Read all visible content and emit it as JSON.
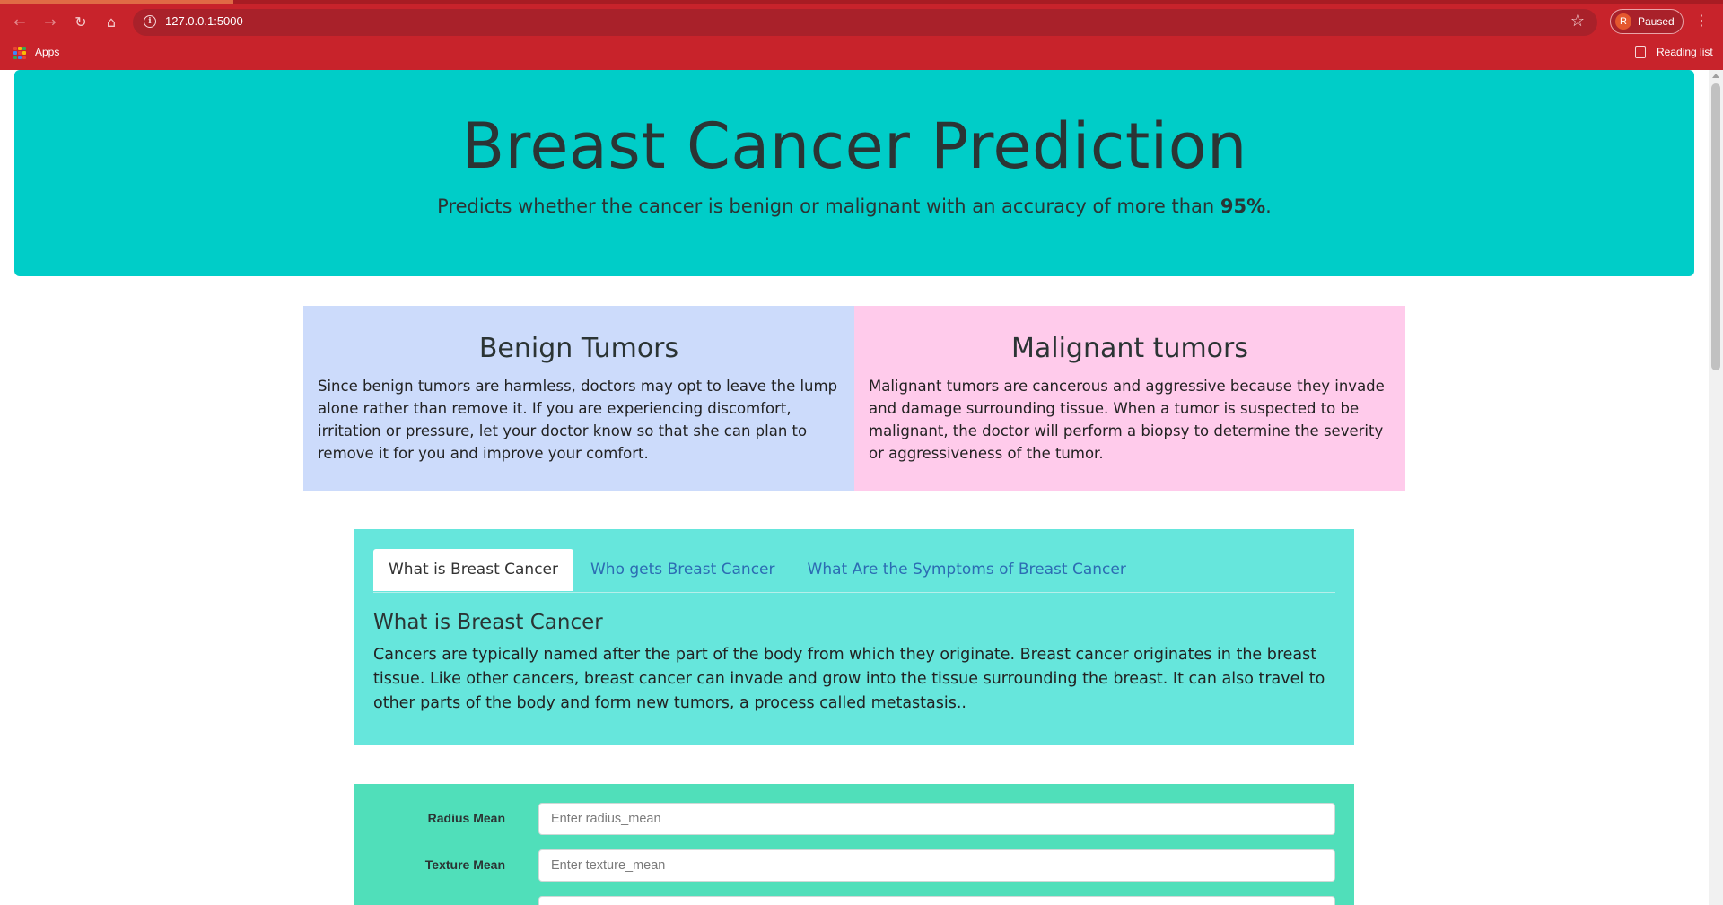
{
  "browser": {
    "url": "127.0.0.1:5000",
    "profile_initial": "R",
    "profile_status": "Paused",
    "bookmarks_apps": "Apps",
    "reading_list": "Reading list",
    "chrome_color": "#c8232b"
  },
  "hero": {
    "title": "Breast Cancer Prediction",
    "subtitle_prefix": "Predicts whether the cancer is benign or malignant with an accuracy of more than ",
    "subtitle_highlight": "95%",
    "subtitle_suffix": ".",
    "background": "#00cdc8"
  },
  "tumors": {
    "benign": {
      "title": "Benign Tumors",
      "text": "Since benign tumors are harmless, doctors may opt to leave the lump alone rather than remove it. If you are experiencing discomfort, irritation or pressure, let your doctor know so that she can plan to remove it for you and improve your comfort.",
      "background": "#ccdbfb"
    },
    "malignant": {
      "title": "Malignant tumors",
      "text": "Malignant tumors are cancerous and aggressive because they invade and damage surrounding tissue. When a tumor is suspected to be malignant, the doctor will perform a biopsy to determine the severity or aggressiveness of the tumor.",
      "background": "#ffcbeb"
    }
  },
  "info": {
    "tabs": [
      {
        "label": "What is Breast Cancer",
        "active": true
      },
      {
        "label": "Who gets Breast Cancer",
        "active": false
      },
      {
        "label": "What Are the Symptoms of Breast Cancer",
        "active": false
      }
    ],
    "heading": "What is Breast Cancer",
    "text": "Cancers are typically named after the part of the body from which they originate. Breast cancer originates in the breast tissue. Like other cancers, breast cancer can invade and grow into the tissue surrounding the breast. It can also travel to other parts of the body and form new tumors, a process called metastasis..",
    "background": "#66e6dc"
  },
  "form": {
    "fields": [
      {
        "label": "Radius Mean",
        "placeholder": "Enter radius_mean",
        "value": ""
      },
      {
        "label": "Texture Mean",
        "placeholder": "Enter texture_mean",
        "value": ""
      },
      {
        "label": "",
        "placeholder": "",
        "value": ""
      }
    ],
    "background": "#50dfba"
  }
}
